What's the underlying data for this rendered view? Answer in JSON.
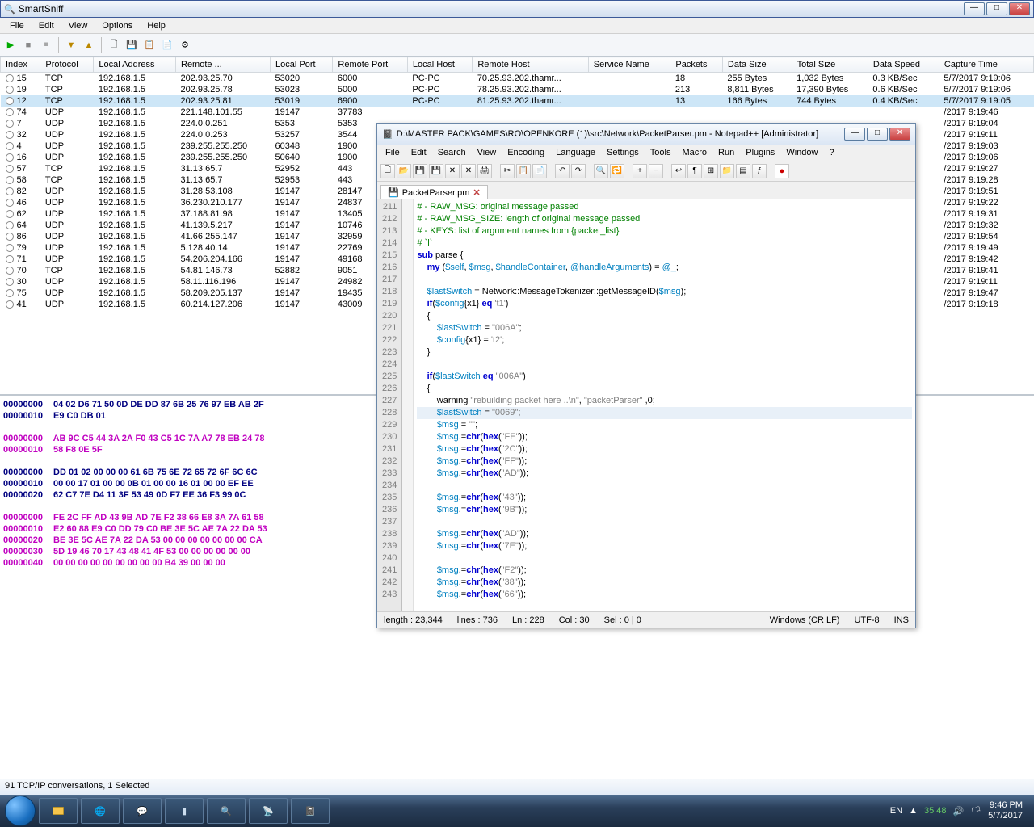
{
  "smartsniff": {
    "title": "SmartSniff",
    "menu": [
      "File",
      "Edit",
      "View",
      "Options",
      "Help"
    ],
    "columns": [
      "Index",
      "Protocol",
      "Local Address",
      "Remote ...",
      "Local Port",
      "Remote Port",
      "Local Host",
      "Remote Host",
      "Service Name",
      "Packets",
      "Data Size",
      "Total Size",
      "Data Speed",
      "Capture Time"
    ],
    "rows": [
      {
        "idx": "15",
        "proto": "TCP",
        "laddr": "192.168.1.5",
        "raddr": "202.93.25.70",
        "lport": "53020",
        "rport": "6000",
        "lhost": "PC-PC",
        "rhost": "70.25.93.202.thamr...",
        "svc": "",
        "pkt": "18",
        "dsize": "255 Bytes",
        "tsize": "1,032 Bytes",
        "speed": "0.3 KB/Sec",
        "ctime": "5/7/2017 9:19:06"
      },
      {
        "idx": "19",
        "proto": "TCP",
        "laddr": "192.168.1.5",
        "raddr": "202.93.25.78",
        "lport": "53023",
        "rport": "5000",
        "lhost": "PC-PC",
        "rhost": "78.25.93.202.thamr...",
        "svc": "",
        "pkt": "213",
        "dsize": "8,811 Bytes",
        "tsize": "17,390 Bytes",
        "speed": "0.6 KB/Sec",
        "ctime": "5/7/2017 9:19:06"
      },
      {
        "idx": "12",
        "proto": "TCP",
        "laddr": "192.168.1.5",
        "raddr": "202.93.25.81",
        "lport": "53019",
        "rport": "6900",
        "lhost": "PC-PC",
        "rhost": "81.25.93.202.thamr...",
        "svc": "",
        "pkt": "13",
        "dsize": "166 Bytes",
        "tsize": "744 Bytes",
        "speed": "0.4 KB/Sec",
        "ctime": "5/7/2017 9:19:05",
        "sel": true
      },
      {
        "idx": "74",
        "proto": "UDP",
        "laddr": "192.168.1.5",
        "raddr": "221.148.101.55",
        "lport": "19147",
        "rport": "37783",
        "lhost": "",
        "rhost": "",
        "svc": "",
        "pkt": "",
        "dsize": "",
        "tsize": "",
        "speed": "",
        "ctime": "/2017 9:19:46"
      },
      {
        "idx": "7",
        "proto": "UDP",
        "laddr": "192.168.1.5",
        "raddr": "224.0.0.251",
        "lport": "5353",
        "rport": "5353",
        "lhost": "",
        "rhost": "",
        "svc": "",
        "pkt": "",
        "dsize": "",
        "tsize": "",
        "speed": "",
        "ctime": "/2017 9:19:04"
      },
      {
        "idx": "32",
        "proto": "UDP",
        "laddr": "192.168.1.5",
        "raddr": "224.0.0.253",
        "lport": "53257",
        "rport": "3544",
        "lhost": "",
        "rhost": "",
        "svc": "",
        "pkt": "",
        "dsize": "",
        "tsize": "",
        "speed": "",
        "ctime": "/2017 9:19:11"
      },
      {
        "idx": "4",
        "proto": "UDP",
        "laddr": "192.168.1.5",
        "raddr": "239.255.255.250",
        "lport": "60348",
        "rport": "1900",
        "lhost": "",
        "rhost": "",
        "svc": "",
        "pkt": "",
        "dsize": "",
        "tsize": "",
        "speed": "",
        "ctime": "/2017 9:19:03"
      },
      {
        "idx": "16",
        "proto": "UDP",
        "laddr": "192.168.1.5",
        "raddr": "239.255.255.250",
        "lport": "50640",
        "rport": "1900",
        "lhost": "",
        "rhost": "",
        "svc": "",
        "pkt": "",
        "dsize": "",
        "tsize": "",
        "speed": "",
        "ctime": "/2017 9:19:06"
      },
      {
        "idx": "57",
        "proto": "TCP",
        "laddr": "192.168.1.5",
        "raddr": "31.13.65.7",
        "lport": "52952",
        "rport": "443",
        "lhost": "",
        "rhost": "",
        "svc": "",
        "pkt": "",
        "dsize": "",
        "tsize": "",
        "speed": "",
        "ctime": "/2017 9:19:27"
      },
      {
        "idx": "58",
        "proto": "TCP",
        "laddr": "192.168.1.5",
        "raddr": "31.13.65.7",
        "lport": "52953",
        "rport": "443",
        "lhost": "",
        "rhost": "",
        "svc": "",
        "pkt": "",
        "dsize": "",
        "tsize": "",
        "speed": "",
        "ctime": "/2017 9:19:28"
      },
      {
        "idx": "82",
        "proto": "UDP",
        "laddr": "192.168.1.5",
        "raddr": "31.28.53.108",
        "lport": "19147",
        "rport": "28147",
        "lhost": "",
        "rhost": "",
        "svc": "",
        "pkt": "",
        "dsize": "",
        "tsize": "",
        "speed": "",
        "ctime": "/2017 9:19:51"
      },
      {
        "idx": "46",
        "proto": "UDP",
        "laddr": "192.168.1.5",
        "raddr": "36.230.210.177",
        "lport": "19147",
        "rport": "24837",
        "lhost": "",
        "rhost": "",
        "svc": "",
        "pkt": "",
        "dsize": "",
        "tsize": "",
        "speed": "",
        "ctime": "/2017 9:19:22"
      },
      {
        "idx": "62",
        "proto": "UDP",
        "laddr": "192.168.1.5",
        "raddr": "37.188.81.98",
        "lport": "19147",
        "rport": "13405",
        "lhost": "",
        "rhost": "",
        "svc": "",
        "pkt": "",
        "dsize": "",
        "tsize": "",
        "speed": "",
        "ctime": "/2017 9:19:31"
      },
      {
        "idx": "64",
        "proto": "UDP",
        "laddr": "192.168.1.5",
        "raddr": "41.139.5.217",
        "lport": "19147",
        "rport": "10746",
        "lhost": "",
        "rhost": "",
        "svc": "",
        "pkt": "",
        "dsize": "",
        "tsize": "",
        "speed": "",
        "ctime": "/2017 9:19:32"
      },
      {
        "idx": "86",
        "proto": "UDP",
        "laddr": "192.168.1.5",
        "raddr": "41.66.255.147",
        "lport": "19147",
        "rport": "32959",
        "lhost": "",
        "rhost": "",
        "svc": "",
        "pkt": "",
        "dsize": "",
        "tsize": "",
        "speed": "",
        "ctime": "/2017 9:19:54"
      },
      {
        "idx": "79",
        "proto": "UDP",
        "laddr": "192.168.1.5",
        "raddr": "5.128.40.14",
        "lport": "19147",
        "rport": "22769",
        "lhost": "",
        "rhost": "",
        "svc": "",
        "pkt": "",
        "dsize": "",
        "tsize": "",
        "speed": "",
        "ctime": "/2017 9:19:49"
      },
      {
        "idx": "71",
        "proto": "UDP",
        "laddr": "192.168.1.5",
        "raddr": "54.206.204.166",
        "lport": "19147",
        "rport": "49168",
        "lhost": "",
        "rhost": "",
        "svc": "",
        "pkt": "",
        "dsize": "",
        "tsize": "",
        "speed": "",
        "ctime": "/2017 9:19:42"
      },
      {
        "idx": "70",
        "proto": "TCP",
        "laddr": "192.168.1.5",
        "raddr": "54.81.146.73",
        "lport": "52882",
        "rport": "9051",
        "lhost": "",
        "rhost": "",
        "svc": "",
        "pkt": "",
        "dsize": "",
        "tsize": "",
        "speed": "",
        "ctime": "/2017 9:19:41"
      },
      {
        "idx": "30",
        "proto": "UDP",
        "laddr": "192.168.1.5",
        "raddr": "58.11.116.196",
        "lport": "19147",
        "rport": "24982",
        "lhost": "",
        "rhost": "",
        "svc": "",
        "pkt": "",
        "dsize": "",
        "tsize": "",
        "speed": "",
        "ctime": "/2017 9:19:11"
      },
      {
        "idx": "75",
        "proto": "UDP",
        "laddr": "192.168.1.5",
        "raddr": "58.209.205.137",
        "lport": "19147",
        "rport": "19435",
        "lhost": "",
        "rhost": "",
        "svc": "",
        "pkt": "",
        "dsize": "",
        "tsize": "",
        "speed": "",
        "ctime": "/2017 9:19:47"
      },
      {
        "idx": "41",
        "proto": "UDP",
        "laddr": "192.168.1.5",
        "raddr": "60.214.127.206",
        "lport": "19147",
        "rport": "43009",
        "lhost": "",
        "rhost": "",
        "svc": "",
        "pkt": "",
        "dsize": "",
        "tsize": "",
        "speed": "",
        "ctime": "/2017 9:19:18"
      }
    ],
    "hex_blocks": [
      {
        "color": "b1",
        "lines": [
          {
            "off": "00000000",
            "bytes": "04 02 D6 71 50 0D DE DD   87 6B 25 76 97 EB AB 2F"
          },
          {
            "off": "00000010",
            "bytes": "E9 C0 DB 01"
          }
        ]
      },
      {
        "color": "b2",
        "lines": [
          {
            "off": "00000000",
            "bytes": "AB 9C C5 44 3A 2A F0 43   C5 1C 7A A7 78 EB 24 78"
          },
          {
            "off": "00000010",
            "bytes": "58 F8 0E 5F"
          }
        ]
      },
      {
        "color": "b1",
        "lines": [
          {
            "off": "00000000",
            "bytes": "DD 01 02 00 00 00 61 6B   75 6E 72 65 72 6F 6C 6C"
          },
          {
            "off": "00000010",
            "bytes": "00 00 17 01 00 00 0B 01   00 00 16 01 00 00 EF EE"
          },
          {
            "off": "00000020",
            "bytes": "62 C7 7E D4 11 3F 53 49   0D F7 EE 36 F3 99 0C"
          }
        ]
      },
      {
        "color": "b2",
        "lines": [
          {
            "off": "00000000",
            "bytes": "FE 2C FF AD 43 9B AD 7E   F2 38 66 E8 3A 7A 61 58"
          },
          {
            "off": "00000010",
            "bytes": "E2 60 88 E9 C0 DD 79 C0   BE 3E 5C AE 7A 22 DA 53"
          },
          {
            "off": "00000020",
            "bytes": "BE 3E 5C AE 7A 22 DA 53   00 00 00 00 00 00 00 CA"
          },
          {
            "off": "00000030",
            "bytes": "5D 19 46 70 17 43 48 41   4F 53 00 00 00 00 00 00"
          },
          {
            "off": "00000040",
            "bytes": "00 00 00 00 00 00 00 00   00 B4 39 00 00 00"
          }
        ]
      }
    ],
    "status": "91 TCP/IP conversations, 1 Selected"
  },
  "npp": {
    "title": "D:\\MASTER PACK\\GAMES\\RO\\OPENKORE (1)\\src\\Network\\PacketParser.pm - Notepad++ [Administrator]",
    "menu": [
      "File",
      "Edit",
      "Search",
      "View",
      "Encoding",
      "Language",
      "Settings",
      "Tools",
      "Macro",
      "Run",
      "Plugins",
      "Window",
      "?"
    ],
    "tab": "PacketParser.pm",
    "line_start": 211,
    "status": {
      "len": "length : 23,344",
      "lines": "lines : 736",
      "ln": "Ln : 228",
      "col": "Col : 30",
      "sel": "Sel : 0 | 0",
      "eol": "Windows (CR LF)",
      "enc": "UTF-8",
      "ins": "INS"
    }
  },
  "taskbar": {
    "lang": "EN",
    "tray_nums": "35  48",
    "time": "9:46 PM",
    "date": "5/7/2017"
  }
}
